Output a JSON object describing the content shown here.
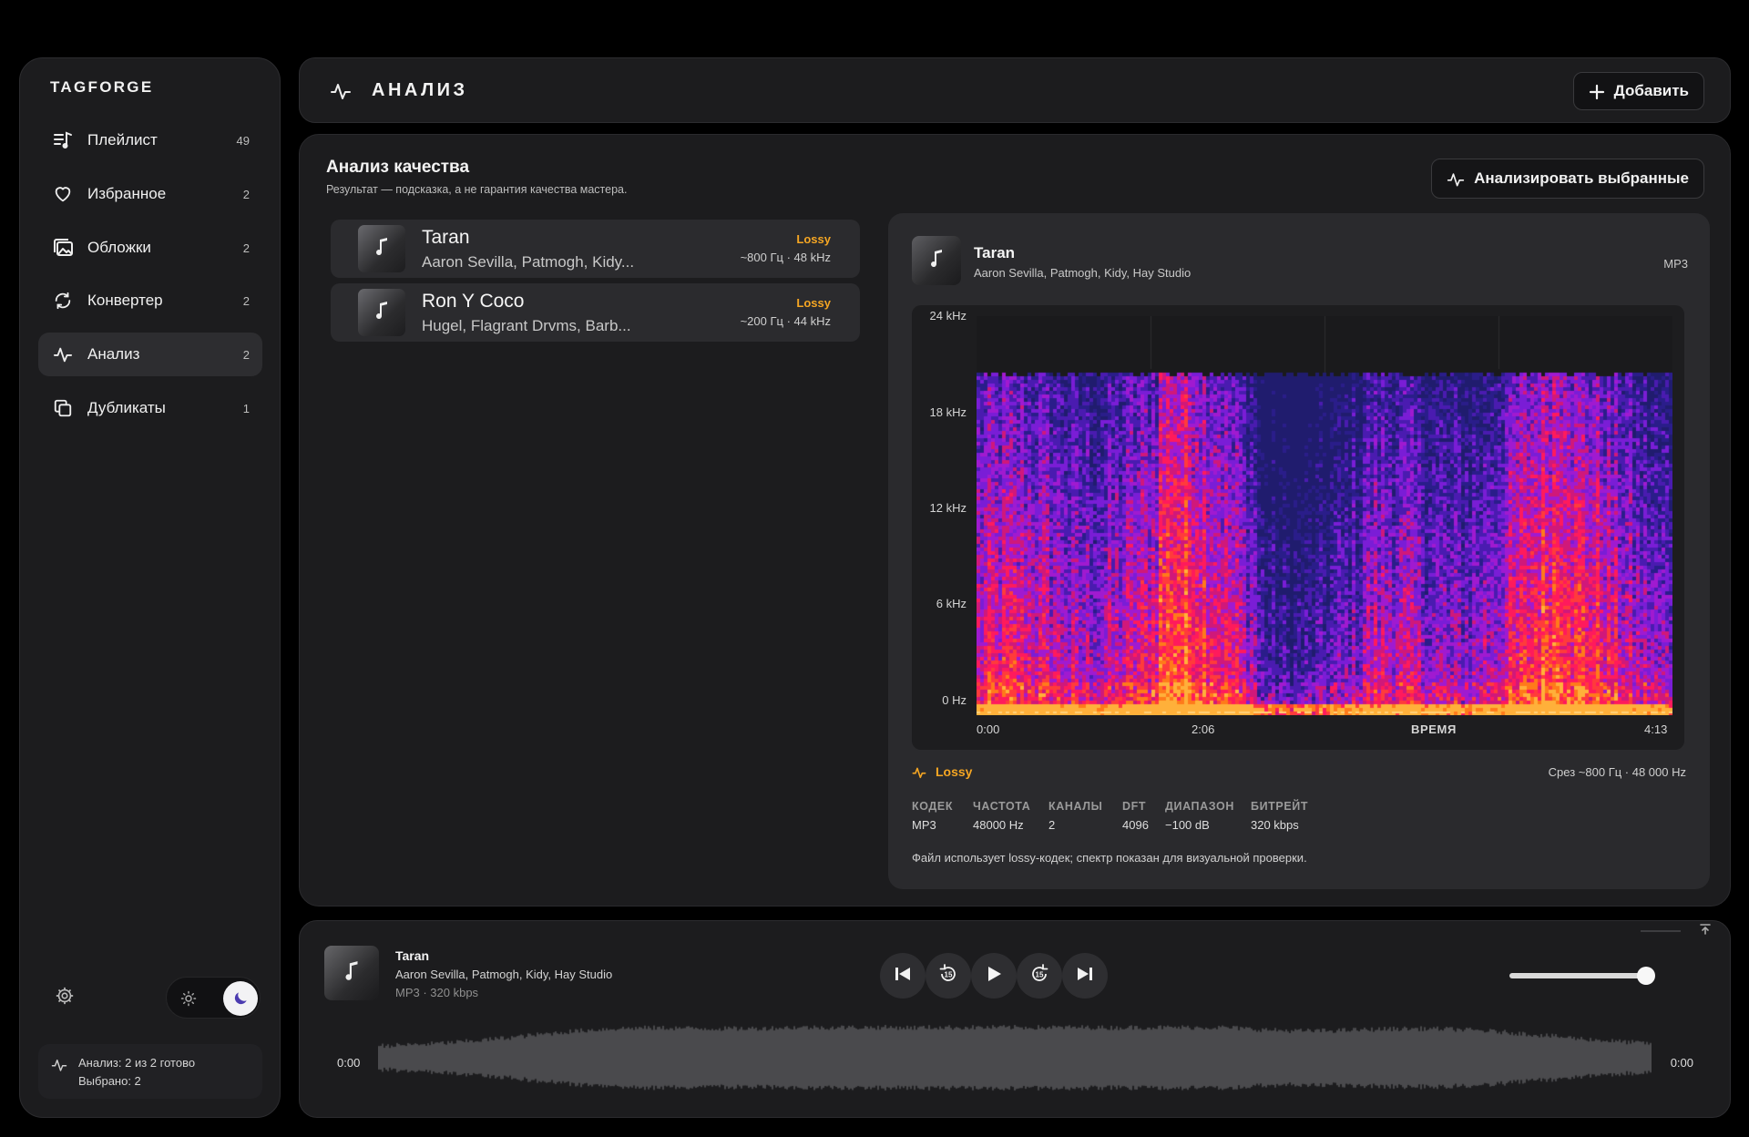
{
  "brand": "TAGFORGE",
  "nav": [
    {
      "label": "Плейлист",
      "count": "49",
      "icon": "playlist-icon"
    },
    {
      "label": "Избранное",
      "count": "2",
      "icon": "heart-icon"
    },
    {
      "label": "Обложки",
      "count": "2",
      "icon": "images-icon"
    },
    {
      "label": "Конвертер",
      "count": "2",
      "icon": "convert-icon"
    },
    {
      "label": "Анализ",
      "count": "2",
      "icon": "pulse-icon",
      "active": true
    },
    {
      "label": "Дубликаты",
      "count": "1",
      "icon": "copy-icon"
    }
  ],
  "status": {
    "line1": "Анализ: 2 из 2 готово",
    "line2": "Выбрано: 2"
  },
  "header": {
    "title": "АНАЛИЗ",
    "add_label": "Добавить"
  },
  "section": {
    "title": "Анализ качества",
    "subtitle": "Результат — подсказка, а не гарантия качества мастера.",
    "analyze_label": "Анализировать выбранные"
  },
  "tracks": [
    {
      "title": "Taran",
      "artist": "Aaron Sevilla, Patmogh, Kidy...",
      "badge": "Lossy",
      "meta": "~800 Гц · 48 kHz"
    },
    {
      "title": "Ron Y Coco",
      "artist": "Hugel, Flagrant Drvms, Barb...",
      "badge": "Lossy",
      "meta": "~200 Гц · 44 kHz"
    }
  ],
  "detail": {
    "title": "Taran",
    "artist": "Aaron Sevilla, Patmogh, Kidy, Hay Studio",
    "format": "MP3",
    "y_labels": [
      "24 kHz",
      "18 kHz",
      "12 kHz",
      "6 kHz",
      "0 Hz"
    ],
    "x_labels": [
      "0:00",
      "2:06",
      "ВРЕМЯ",
      "4:13"
    ],
    "verdict": "Lossy",
    "cutoff": "Срез ~800 Гц · 48 000 Hz",
    "stats": [
      {
        "label": "КОДЕК",
        "value": "MP3"
      },
      {
        "label": "ЧАСТОТА",
        "value": "48000 Hz"
      },
      {
        "label": "КАНАЛЫ",
        "value": "2"
      },
      {
        "label": "DFT",
        "value": "4096"
      },
      {
        "label": "ДИАПАЗОН",
        "value": "−100 dB"
      },
      {
        "label": "БИТРЕЙТ",
        "value": "320 kbps"
      }
    ],
    "note": "Файл использует lossy-кодек; спектр показан для визуальной проверки."
  },
  "player": {
    "title": "Taran",
    "artist": "Aaron Sevilla, Patmogh, Kidy, Hay Studio",
    "format": "MP3 · 320 kbps",
    "time_current": "0:00",
    "time_total": "0:00",
    "volume": 0.9
  },
  "colors": {
    "accent": "#f5a623",
    "spectrum_low": "#2a1d8a",
    "spectrum_mid": "#8a1ee0",
    "spectrum_high": "#ff1a5c",
    "spectrum_peak": "#ff9a1a"
  }
}
